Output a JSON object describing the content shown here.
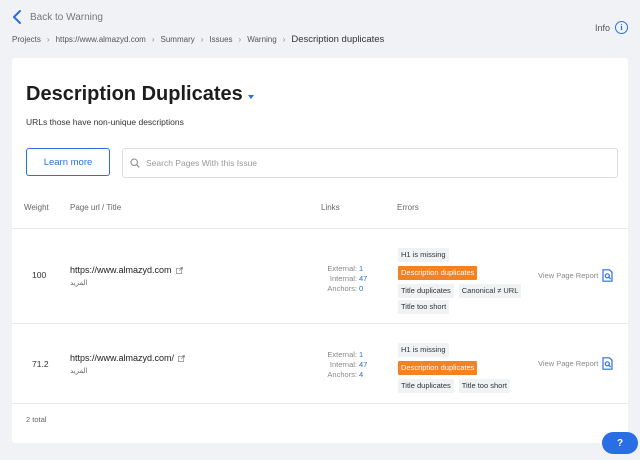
{
  "nav": {
    "back_label": "Back to Warning",
    "info_label": "Info"
  },
  "breadcrumbs": [
    "Projects",
    "https://www.almazyd.com",
    "Summary",
    "Issues",
    "Warning"
  ],
  "breadcrumb_current": "Description duplicates",
  "page": {
    "title": "Description Duplicates",
    "subtitle": "URLs those have non-unique descriptions",
    "learn_more_label": "Learn more",
    "search_placeholder": "Search Pages With this Issue"
  },
  "table": {
    "headers": {
      "weight": "Weight",
      "page_url": "Page url / Title",
      "links": "Links",
      "errors": "Errors"
    },
    "link_labels": {
      "external": "External:",
      "internal": "Internal:",
      "anchors": "Anchors:"
    },
    "view_report_label": "View Page Report",
    "rows": [
      {
        "weight": "100",
        "url": "https://www.almazyd.com",
        "title": "المزيد",
        "external": "1",
        "internal": "47",
        "anchors": "0",
        "errors": [
          "H1 is missing",
          "Description duplicates",
          "Title duplicates",
          "Canonical ≠ URL",
          "Title too short"
        ]
      },
      {
        "weight": "71.2",
        "url": "https://www.almazyd.com/",
        "title": "المزيد",
        "external": "1",
        "internal": "47",
        "anchors": "4",
        "errors": [
          "H1 is missing",
          "Description duplicates",
          "Title duplicates",
          "Title too short"
        ]
      }
    ],
    "total_label": "2 total"
  },
  "help_label": "?",
  "colors": {
    "accent": "#2a6ee6",
    "highlight_tag": "#f58220",
    "tag_bg": "#f1f2f4",
    "page_bg": "#f1f2f5"
  }
}
